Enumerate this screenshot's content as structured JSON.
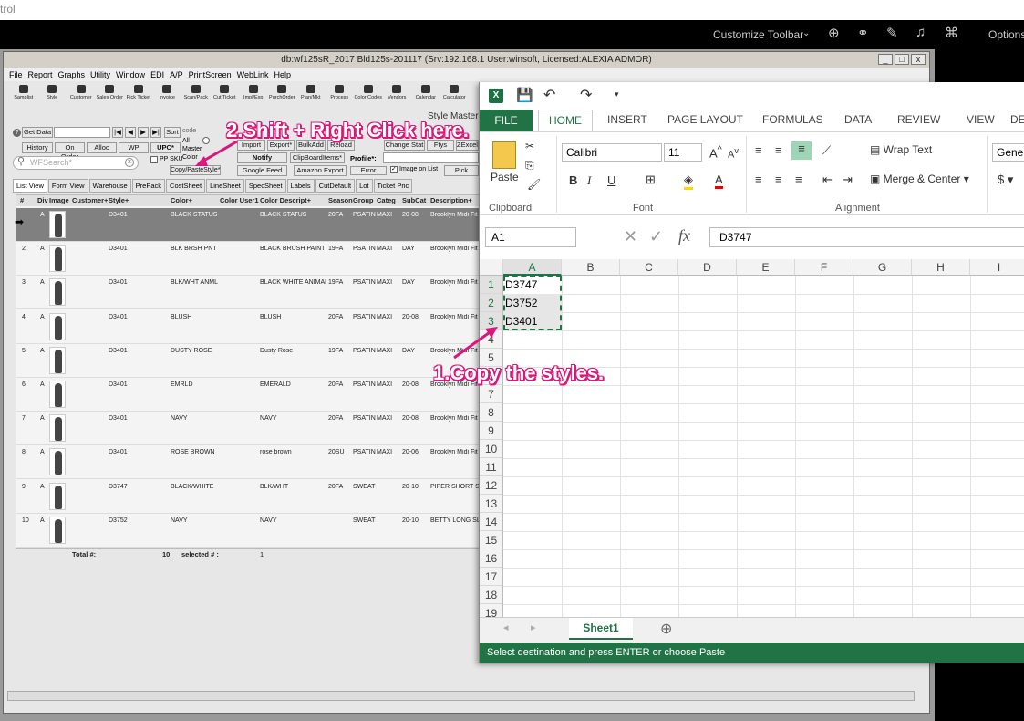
{
  "top": {
    "label": "trol"
  },
  "blackbar": {
    "customize": "Customize Toolbar",
    "options": "Options"
  },
  "app": {
    "title": "db:wf125sR_2017 Bld125s-201117 (Srv:192.168.1 User:winsoft, Licensed:ALEXIA ADMOR)",
    "menu": [
      "File",
      "Report",
      "Graphs",
      "Utility",
      "Window",
      "EDI",
      "A/P",
      "PrintScreen",
      "WebLink",
      "Help"
    ],
    "toolbar": [
      "Samplist",
      "Style",
      "Customer",
      "Sales Order",
      "Pick Ticket",
      "Invoice",
      "Scan/Pack",
      "Cut Ticket",
      "Impl/Exp",
      "PurchOrder",
      "Plan/Mkt",
      "Process",
      "Color Codes",
      "Vendors",
      "Calendar",
      "Calculator"
    ],
    "window_label": "Style Master",
    "buttons": {
      "get_data": "Get Data",
      "sort": "Sort",
      "history": "History",
      "on_order": "On Order",
      "alloc": "Alloc",
      "wp": "WP",
      "upc": "UPC*",
      "import": "Import",
      "export": "Export*",
      "bulkadd": "BulkAdd",
      "reload": "Reload",
      "change_stat": "Change Stat",
      "ftys_invt": "Ftys Invt",
      "zexcel": "ZExcel",
      "copy_paste": "Copy/PasteStyle*",
      "notify": "Notify",
      "clipboard": "ClipBoardItems*",
      "profile": "Profile*:",
      "google_feed": "Google Feed",
      "amazon_export": "Amazon Export",
      "error": "Error",
      "image_on_list": "Image on List",
      "pick": "Pick",
      "all": "All",
      "master": "Master",
      "color": "Color",
      "code": "code",
      "pp_sku": "PP SKU"
    },
    "search_placeholder": "WFSearch*",
    "tabs": [
      "List View",
      "Form View",
      "Warehouse",
      "PrePack",
      "CostSheet",
      "LineSheet",
      "SpecSheet",
      "Labels",
      "CutDefault",
      "Lot",
      "Ticket Pric"
    ],
    "columns": [
      "#",
      "Div",
      "Image",
      "Customer+",
      "Style+",
      "Color+",
      "Color User1",
      "Color Descript+",
      "Season",
      "Group",
      "Categ",
      "SubCat",
      "Description+"
    ],
    "rows": [
      {
        "n": "",
        "div": "A",
        "style": "D3401",
        "color": "BLACK STATUS",
        "desc": "BLACK STATUS",
        "season": "20FA",
        "group": "PSATIN",
        "categ": "MAXI",
        "subcat": "20-08",
        "description": "Brooklyn Midi Fit"
      },
      {
        "n": "2",
        "div": "A",
        "style": "D3401",
        "color": "BLK BRSH PNT",
        "desc": "BLACK BRUSH PAINTEI",
        "season": "19FA",
        "group": "PSATIN",
        "categ": "MAXI",
        "subcat": "DAY",
        "description": "Brooklyn Midi Fit"
      },
      {
        "n": "3",
        "div": "A",
        "style": "D3401",
        "color": "BLK/WHT ANML",
        "desc": "BLACK WHITE ANIMAL",
        "season": "19FA",
        "group": "PSATIN",
        "categ": "MAXI",
        "subcat": "DAY",
        "description": "Brooklyn Midi Fit"
      },
      {
        "n": "4",
        "div": "A",
        "style": "D3401",
        "color": "BLUSH",
        "desc": "BLUSH",
        "season": "20FA",
        "group": "PSATIN",
        "categ": "MAXI",
        "subcat": "20-08",
        "description": "Brooklyn Midi Fit"
      },
      {
        "n": "5",
        "div": "A",
        "style": "D3401",
        "color": "DUSTY ROSE",
        "desc": "Dusty Rose",
        "season": "19FA",
        "group": "PSATIN",
        "categ": "MAXI",
        "subcat": "DAY",
        "description": "Brooklyn Midi Fit"
      },
      {
        "n": "6",
        "div": "A",
        "style": "D3401",
        "color": "EMRLD",
        "desc": "EMERALD",
        "season": "20FA",
        "group": "PSATIN",
        "categ": "MAXI",
        "subcat": "20-08",
        "description": "Brooklyn Midi Fit"
      },
      {
        "n": "7",
        "div": "A",
        "style": "D3401",
        "color": "NAVY",
        "desc": "NAVY",
        "season": "20FA",
        "group": "PSATIN",
        "categ": "MAXI",
        "subcat": "20-08",
        "description": "Brooklyn Midi Fit"
      },
      {
        "n": "8",
        "div": "A",
        "style": "D3401",
        "color": "ROSE BROWN",
        "desc": "rose brown",
        "season": "20SU",
        "group": "PSATIN",
        "categ": "MAXI",
        "subcat": "20-06",
        "description": "Brooklyn Midi Fit"
      },
      {
        "n": "9",
        "div": "A",
        "style": "D3747",
        "color": "BLACK/WHITE",
        "desc": "BLK/WHT",
        "season": "20FA",
        "group": "SWEATK",
        "categ": "",
        "subcat": "20-10",
        "description": "PIPER SHORT SL"
      },
      {
        "n": "10",
        "div": "A",
        "style": "D3752",
        "color": "NAVY",
        "desc": "NAVY",
        "season": "",
        "group": "SWEATK",
        "categ": "",
        "subcat": "20-10",
        "description": "BETTY LONG SL"
      }
    ],
    "totals": {
      "label": "Total #:",
      "count": "10",
      "selected_label": "selected # :",
      "selected": "1"
    }
  },
  "excel": {
    "ribbon_tabs": [
      "FILE",
      "HOME",
      "INSERT",
      "PAGE LAYOUT",
      "FORMULAS",
      "DATA",
      "REVIEW",
      "VIEW",
      "DE"
    ],
    "font_name": "Calibri",
    "font_size": "11",
    "paste": "Paste",
    "wrap_text": "Wrap Text",
    "merge_center": "Merge & Center",
    "number_format": "Genera",
    "groups": [
      "Clipboard",
      "Font",
      "Alignment"
    ],
    "name_box": "A1",
    "formula": "D3747",
    "columns": [
      "A",
      "B",
      "C",
      "D",
      "E",
      "F",
      "G",
      "H",
      "I"
    ],
    "row_numbers": [
      "1",
      "2",
      "3",
      "4",
      "5",
      "6",
      "7",
      "8",
      "9",
      "10",
      "11",
      "12",
      "13",
      "14",
      "15",
      "16",
      "17",
      "18",
      "19"
    ],
    "cells": [
      "D3747",
      "D3752",
      "D3401"
    ],
    "sheet_tab": "Sheet1",
    "status": "Select destination and press ENTER or choose Paste",
    "accent": "#217346"
  },
  "annotations": {
    "step1": "1.Copy the styles.",
    "step2": "2.Shift + Right Click here.",
    "color": "#d6197b"
  }
}
